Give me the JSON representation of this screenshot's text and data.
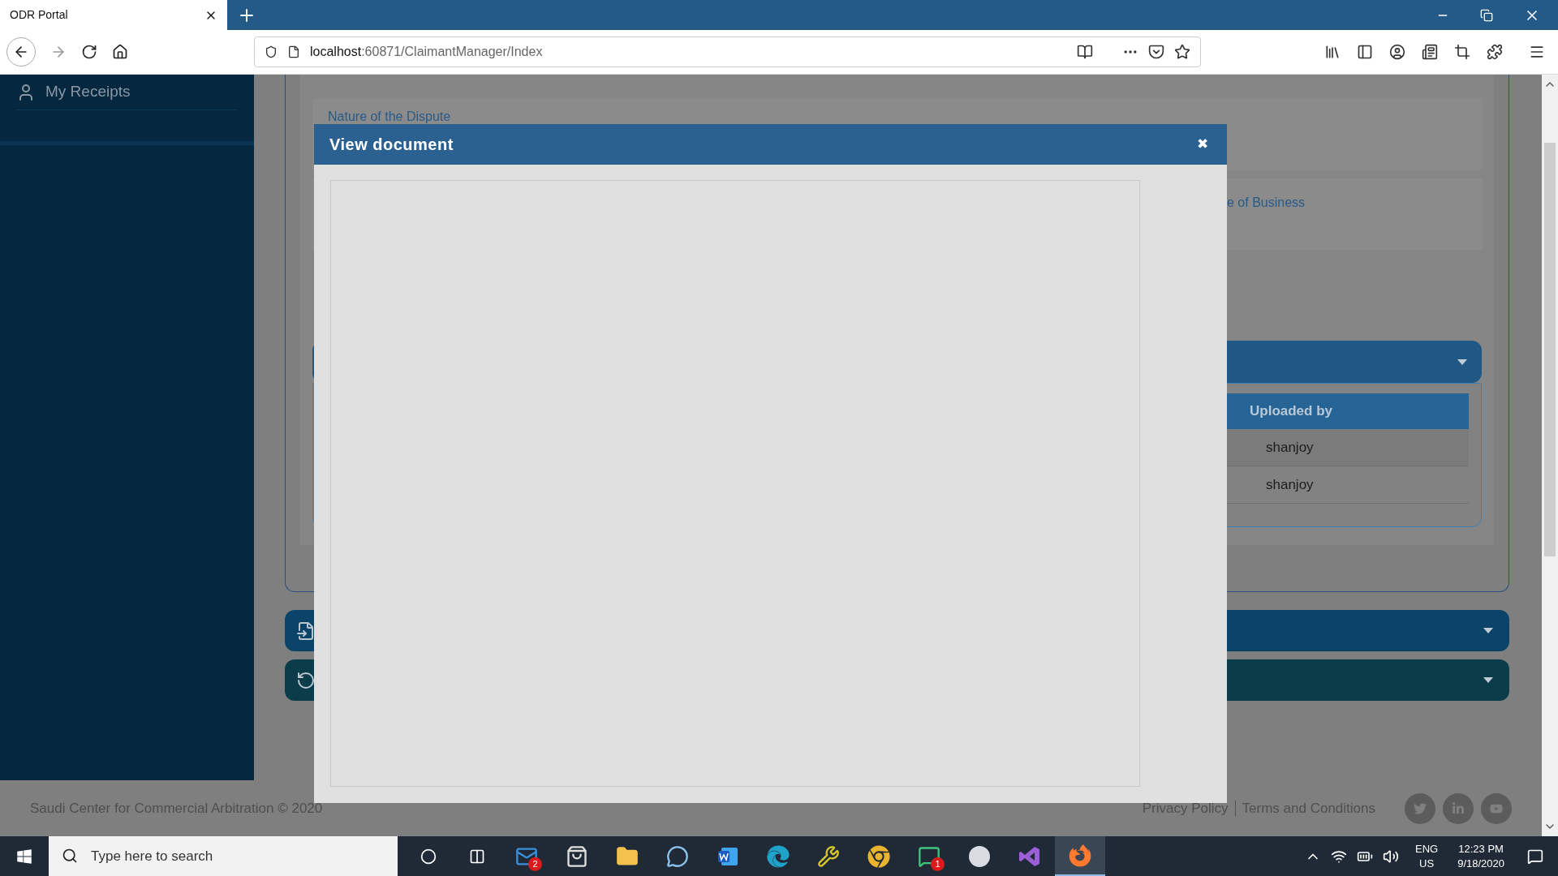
{
  "browser": {
    "tab": {
      "title": "ODR Portal",
      "selected": true
    },
    "url_host": "localhost",
    "url_path": ":60871/ClaimantManager/Index"
  },
  "sidebar": {
    "items": [
      {
        "label": "My Receipts"
      }
    ]
  },
  "page": {
    "cards": [
      {
        "label": "Nature of the Dispute"
      },
      {
        "label": "e of Business"
      }
    ],
    "accordions": [
      {
        "expanded": true,
        "color": "#1f5884"
      },
      {
        "kind": "file",
        "color": "#0b4468"
      },
      {
        "kind": "refresh",
        "color": "#0a3c4a"
      }
    ],
    "documents_table": {
      "columns": [
        "Uploaded by"
      ],
      "rows": [
        [
          "shanjoy"
        ],
        [
          "shanjoy"
        ]
      ]
    }
  },
  "modal": {
    "title": "View document",
    "close": "✖"
  },
  "footer": {
    "copyright": "Saudi Center for Commercial Arbitration © 2020",
    "links": [
      "Privacy Policy",
      "Terms and Conditions"
    ]
  },
  "taskbar": {
    "search_placeholder": "Type here to search",
    "apps": [
      {
        "kind": "mail",
        "badge": "2",
        "selected": false
      },
      {
        "kind": "store",
        "selected": false
      },
      {
        "kind": "folder",
        "selected": false
      },
      {
        "kind": "outlook",
        "selected": false
      },
      {
        "kind": "word",
        "selected": false
      },
      {
        "kind": "edge",
        "selected": false
      },
      {
        "kind": "tool",
        "selected": false
      },
      {
        "kind": "chrome",
        "selected": false
      },
      {
        "kind": "chat",
        "badge": "1",
        "selected": false
      },
      {
        "kind": "ball",
        "selected": false
      },
      {
        "kind": "studio",
        "selected": false
      },
      {
        "kind": "firefox",
        "selected": true
      }
    ]
  },
  "tray": {
    "language": "ENG",
    "region": "US",
    "time": "12:23 PM",
    "date": "9/18/2020"
  }
}
